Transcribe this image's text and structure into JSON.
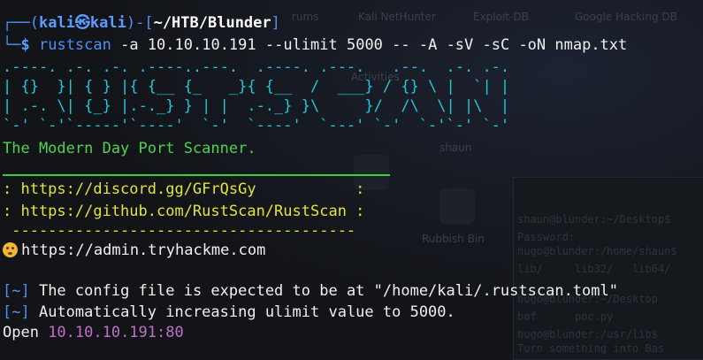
{
  "prompt": {
    "user": "kali",
    "at_glyph": "㉿",
    "host": "kali",
    "cwd": "~/HTB/Blunder",
    "symbol": "$",
    "command": "rustscan",
    "args": " -a 10.10.10.191 --ulimit 5000 -- -A -sV -sC -oN nmap.txt"
  },
  "banner": {
    "ascii": [
      ".----. .-. .-. .----..---.  .----. .---.   .--.  .-. .-.",
      "| {}  }| { } |{ {__ {_   _}{ {__  /  ___} / {} \\ |  `| |",
      "| .-. \\| {_} |.-._} } | |  .-._} }\\     }/  /\\  \\| |\\  |",
      "`-' `-'`-----'`----'  `-'  `----'  `---' `-'  `-'`-' `-'"
    ],
    "tagline": "The Modern Day Port Scanner."
  },
  "links": [
    ": https://discord.gg/GFrQsGy           :",
    ": https://github.com/RustScan/RustScan :"
  ],
  "dashes": " --------------------------------------",
  "tip_url": "https://admin.tryhackme.com",
  "messages": [
    {
      "tag": "[~]",
      "text": " The config file is expected to be at \"/home/kali/.rustscan.toml\""
    },
    {
      "tag": "[~]",
      "text": " Automatically increasing ulimit value to 5000."
    }
  ],
  "open": {
    "label": "Open ",
    "address": "10.10.10.191:80"
  },
  "background": {
    "tabs": [
      "rums",
      "Kali NetHunter",
      "Exploit-DB",
      "Google Hacking DB"
    ],
    "desktop_icons": [
      "Activities",
      "shaun",
      "Rubbish Bin"
    ],
    "terminal_lines": [
      "shaun@blunder:~/Desktop$",
      "Password:",
      "hugo@blunder:/home/shaun$",
      "lib/     lib32/   lib64/",
      "hugo@blunder:~/Desktop",
      "bof      poc.py",
      "hugo@blunder:/usr/lib$",
      "Turn something into Bas"
    ]
  },
  "colors": {
    "prompt_blue": "#4f8ff7",
    "ascii_cyan": "#20c8d8",
    "tagline_green": "#4fd24f",
    "link_yellow": "#e3e33a",
    "ip_magenta": "#c070c8"
  }
}
